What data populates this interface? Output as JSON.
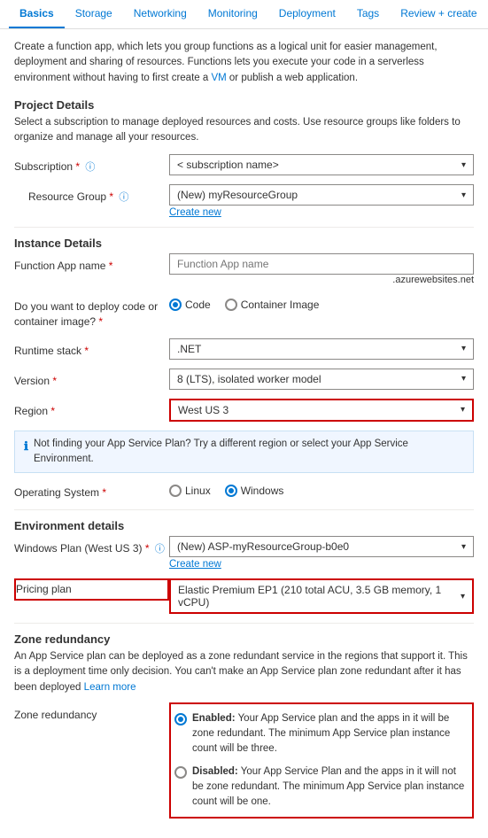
{
  "tabs": [
    {
      "id": "basics",
      "label": "Basics",
      "active": true
    },
    {
      "id": "storage",
      "label": "Storage",
      "active": false
    },
    {
      "id": "networking",
      "label": "Networking",
      "active": false
    },
    {
      "id": "monitoring",
      "label": "Monitoring",
      "active": false
    },
    {
      "id": "deployment",
      "label": "Deployment",
      "active": false
    },
    {
      "id": "tags",
      "label": "Tags",
      "active": false
    },
    {
      "id": "review-create",
      "label": "Review + create",
      "active": false
    }
  ],
  "description": "Create a function app, which lets you group functions as a logical unit for easier management, deployment and sharing of resources. Functions lets you execute your code in a serverless environment without having to first create a VM or publish a web application.",
  "description_vm_link": "VM",
  "project_details": {
    "title": "Project Details",
    "desc": "Select a subscription to manage deployed resources and costs. Use resource groups like folders to organize and manage all your resources.",
    "subscription_label": "Subscription",
    "subscription_value": "< subscription name>",
    "resource_group_label": "Resource Group",
    "resource_group_value": "(New) myResourceGroup",
    "create_new": "Create new"
  },
  "instance_details": {
    "title": "Instance Details",
    "function_app_name_label": "Function App name",
    "function_app_name_placeholder": "Function App name",
    "suffix": ".azurewebsites.net",
    "deploy_label": "Do you want to deploy code or container image?",
    "code_option": "Code",
    "container_option": "Container Image",
    "runtime_stack_label": "Runtime stack",
    "runtime_stack_value": ".NET",
    "version_label": "Version",
    "version_value": "8 (LTS), isolated worker model",
    "region_label": "Region",
    "region_value": "West US 3",
    "region_info": "Not finding your App Service Plan? Try a different region or select your App Service Environment.",
    "os_label": "Operating System",
    "os_linux": "Linux",
    "os_windows": "Windows"
  },
  "environment_details": {
    "title": "Environment details",
    "windows_plan_label": "Windows Plan (West US 3)",
    "windows_plan_value": "(New) ASP-myResourceGroup-b0e0",
    "create_new": "Create new",
    "pricing_plan_label": "Pricing plan",
    "pricing_plan_value": "Elastic Premium EP1 (210 total ACU, 3.5 GB memory, 1 vCPU)"
  },
  "zone_redundancy": {
    "title": "Zone redundancy",
    "desc": "An App Service plan can be deployed as a zone redundant service in the regions that support it. This is a deployment time only decision. You can't make an App Service plan zone redundant after it has been deployed",
    "learn_more": "Learn more",
    "label": "Zone redundancy",
    "enabled_label": "Enabled:",
    "enabled_desc": "Your App Service plan and the apps in it will be zone redundant. The minimum App Service plan instance count will be three.",
    "disabled_label": "Disabled:",
    "disabled_desc": "Your App Service Plan and the apps in it will not be zone redundant. The minimum App Service plan instance count will be one."
  }
}
